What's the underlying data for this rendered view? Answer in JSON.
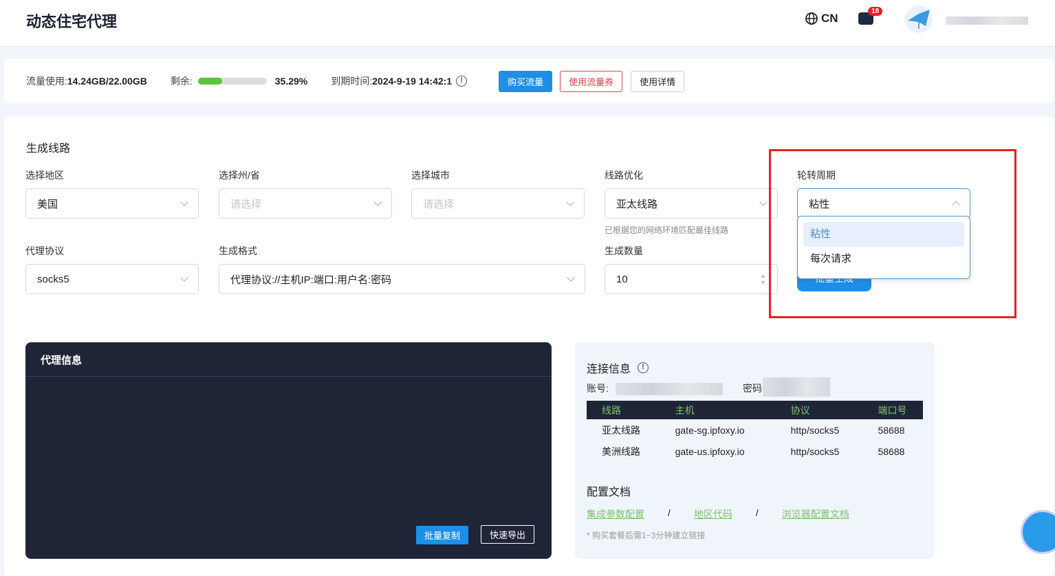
{
  "header": {
    "title": "动态住宅代理",
    "lang": "CN",
    "badge": "18"
  },
  "usage": {
    "used_label": "流量使用:",
    "used_value": "14.24GB/22.00GB",
    "remain_label": "剩余:",
    "remain_percent": 35.29,
    "remain_text": "35.29%",
    "expire_label": "到期时间:",
    "expire_value": "2024-9-19 14:42:1",
    "buy": "购买流量",
    "coupon": "使用流量券",
    "details": "使用详情"
  },
  "gen": {
    "title": "生成线路",
    "region": {
      "label": "选择地区",
      "value": "美国"
    },
    "state": {
      "label": "选择州/省",
      "placeholder": "请选择"
    },
    "city": {
      "label": "选择城市",
      "placeholder": "请选择"
    },
    "route": {
      "label": "线路优化",
      "value": "亚太线路",
      "hint": "已根据您的网络环境匹配最佳线路"
    },
    "rotation": {
      "label": "轮转周期",
      "value": "粘性",
      "options": [
        "粘性",
        "每次请求"
      ]
    },
    "protocol": {
      "label": "代理协议",
      "value": "socks5"
    },
    "format": {
      "label": "生成格式",
      "value": "代理协议://主机IP:端口:用户名:密码"
    },
    "count": {
      "label": "生成数量",
      "value": "10"
    },
    "generate": "批量生成"
  },
  "proxy": {
    "title": "代理信息",
    "copy": "批量复制",
    "export": "快速导出"
  },
  "conn": {
    "title": "连接信息",
    "account_label": "账号:",
    "password_label": "密码",
    "headers": [
      "线路",
      "主机",
      "协议",
      "端口号"
    ],
    "rows": [
      [
        "亚太线路",
        "gate-sg.ipfoxy.io",
        "http/socks5",
        "58688"
      ],
      [
        "美洲线路",
        "gate-us.ipfoxy.io",
        "http/socks5",
        "58688"
      ]
    ],
    "docs_title": "配置文档",
    "links": [
      "集成参数配置",
      "地区代码",
      "浏览器配置文档"
    ],
    "sep": "/",
    "note": "* 购买套餐后需1~3分钟建立链接"
  },
  "colors": {
    "accent": "#1e8fe8",
    "green": "#7cc36a",
    "dark": "#1f2537"
  }
}
